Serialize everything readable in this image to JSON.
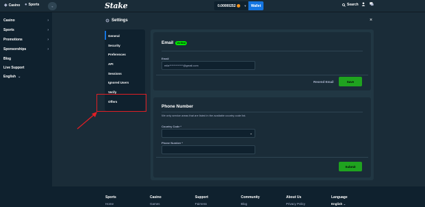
{
  "topbar": {
    "casino_tab": "Casino",
    "sports_tab": "Sports",
    "collapse_label": "«",
    "logo": "Stake",
    "balance": "0.00000252",
    "wallet_label": "Wallet",
    "search_label": "Search"
  },
  "sidebar": {
    "items": [
      {
        "label": "Casino",
        "arrow": "›"
      },
      {
        "label": "Sports",
        "arrow": "›"
      },
      {
        "label": "Promotions",
        "arrow": "›"
      },
      {
        "label": "Sponsorships",
        "arrow": "›"
      },
      {
        "label": "Blog",
        "arrow": ""
      },
      {
        "label": "Live Support",
        "arrow": ""
      },
      {
        "label": "English",
        "arrow": ""
      }
    ]
  },
  "settings": {
    "title": "Settings",
    "close": "×",
    "nav": [
      "General",
      "Security",
      "Preferences",
      "API",
      "Sessions",
      "Ignored Users",
      "Verify",
      "Offers"
    ]
  },
  "email_card": {
    "title": "Email",
    "badge": "Verified",
    "field_label": "Email",
    "field_value": "mila*************@gmail.com",
    "resend_label": "Resend Email",
    "save_label": "Save"
  },
  "phone_card": {
    "title": "Phone Number",
    "description": "We only service areas that are listed in the available country code list.",
    "country_label": "Country Code *",
    "phone_label": "Phone Number *",
    "submit_label": "Submit"
  },
  "footer": {
    "columns": [
      {
        "head": "Sports",
        "link": "Home"
      },
      {
        "head": "Casino",
        "link": "Games"
      },
      {
        "head": "Support",
        "link": "Fairness"
      },
      {
        "head": "Community",
        "link": "Blog"
      },
      {
        "head": "About Us",
        "link": "Privacy Policy"
      },
      {
        "head": "Language",
        "link": "English"
      }
    ]
  },
  "colors": {
    "accent": "#1475e1",
    "success": "#1fa31f",
    "highlight": "#e31e24"
  }
}
